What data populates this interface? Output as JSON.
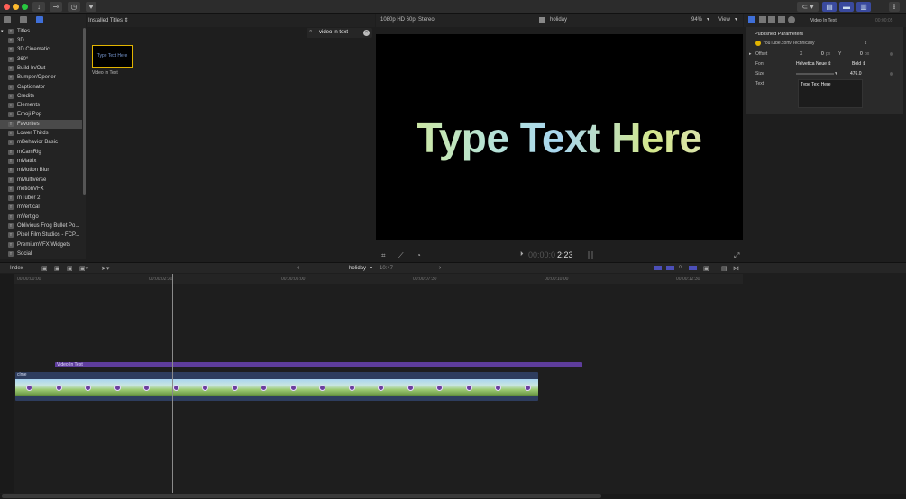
{
  "window": {
    "traffic": [
      "#ff5f57",
      "#febc2e",
      "#28c840"
    ]
  },
  "library": {
    "root": "Titles",
    "items": [
      "3D",
      "3D Cinematic",
      "360°",
      "Build In/Out",
      "Bumper/Opener",
      "Captionator",
      "Credits",
      "Elements",
      "Emoji Pop",
      "Favorites",
      "Lower Thirds",
      "mBehavior Basic",
      "mCamRig",
      "mMatrix",
      "mMotion Blur",
      "mMultiverse",
      "motionVFX",
      "mTuber 2",
      "mVertical",
      "mVertigo",
      "Oblivious Frog Bullet Po...",
      "Pixel Film Studios - FCP...",
      "PremiumVFX Widgets",
      "Social"
    ],
    "selected_index": 9
  },
  "browser": {
    "header": "Installed Titles ⇕",
    "search_value": "video in text",
    "thumb_text": "Type Text Here",
    "thumb_label": "Video In Text"
  },
  "viewer": {
    "format": "1080p HD 60p, Stereo",
    "project": "holiday",
    "zoom": "94%",
    "view": "View",
    "display_text": "Type Text Here",
    "timecode_dim": "00:00:0",
    "timecode": "2:23"
  },
  "inspector": {
    "title": "Video In Text",
    "tc": "00:00:05",
    "section": "Published Parameters",
    "preset": "YouTube.com/iTechnically",
    "offset_label": "Offset",
    "x_label": "X",
    "x_value": "0",
    "x_unit": "px",
    "y_label": "Y",
    "y_value": "0",
    "y_unit": "px",
    "font_label": "Font",
    "font_value": "Helvetica Neue ⇕",
    "weight_value": "Bold ⇕",
    "size_label": "Size",
    "size_value": "476.0",
    "text_label": "Text",
    "text_value": "Type Text Here"
  },
  "timeline": {
    "index": "Index",
    "project": "holiday",
    "duration": "10:47",
    "ticks": [
      "00:00:00:00",
      "00:00:02:30",
      "00:00:05:00",
      "00:00:07:30",
      "00:00:10:00",
      "00:00:12:30"
    ],
    "title_clip": "Video In Text",
    "video_clip": "clme"
  },
  "colors": {
    "accent": "#5e3d9c",
    "thumb_border": "#e2b400",
    "clip_bg": "#2e3d5e"
  }
}
